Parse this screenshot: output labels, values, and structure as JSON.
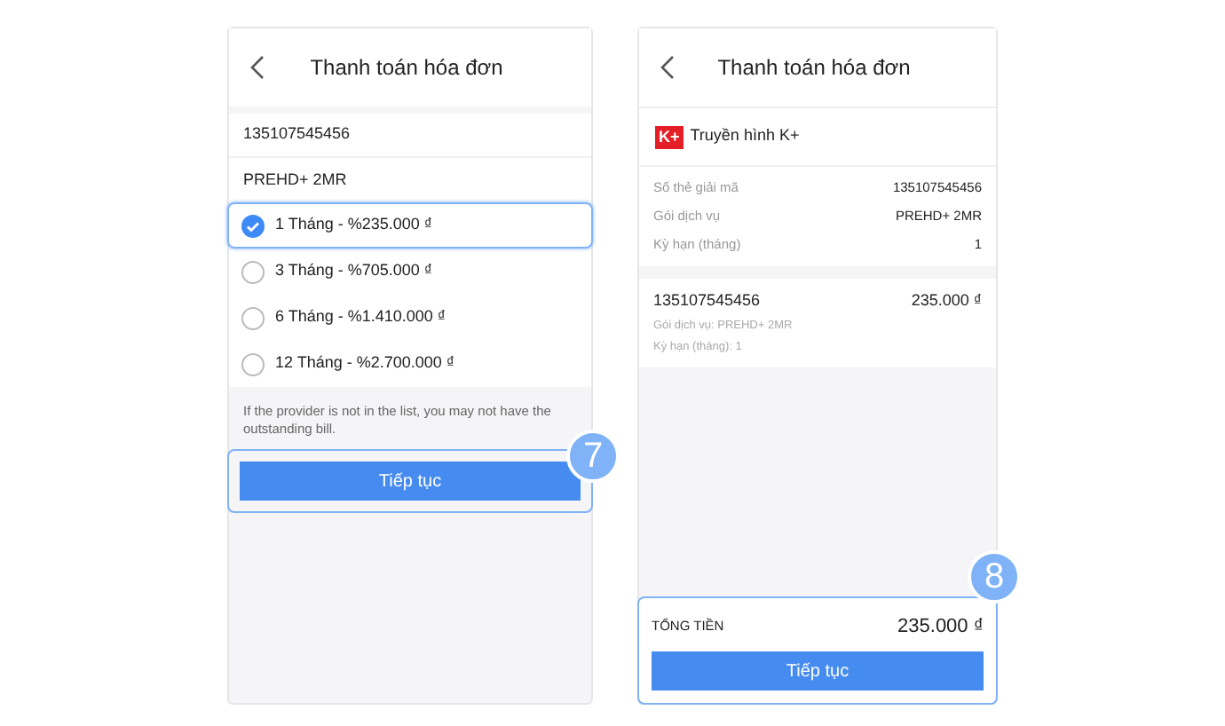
{
  "screen_1": {
    "title": "Thanh toán hóa đơn",
    "account": "135107545456",
    "package": "PREHD+ 2MR",
    "options": [
      {
        "label": "1 Tháng - %235.000 ₫",
        "selected": true
      },
      {
        "label": "3 Tháng - %705.000 ₫",
        "selected": false
      },
      {
        "label": "6 Tháng - %1.410.000 ₫",
        "selected": false
      },
      {
        "label": "12 Tháng - %2.700.000 ₫",
        "selected": false
      }
    ],
    "note": "If the provider is not in the list, you may not have the outstanding bill.",
    "button": "Tiếp tục",
    "step": "7"
  },
  "screen_2": {
    "title": "Thanh toán hóa đơn",
    "provider": {
      "logo": "K+",
      "name": "Truyền hình K+"
    },
    "details": [
      {
        "label": "Số thẻ giải mã",
        "value": "135107545456"
      },
      {
        "label": "Gói dịch vụ",
        "value": "PREHD+ 2MR"
      },
      {
        "label": "Kỳ hạn (tháng)",
        "value": "1"
      }
    ],
    "item": {
      "title": "135107545456",
      "amount": "235.000 ₫",
      "lines": [
        "Gói dịch vụ: PREHD+ 2MR",
        "Kỳ hạn (tháng): 1"
      ]
    },
    "total_label": "TỔNG TIỀN",
    "total": "235.000 ₫",
    "button": "Tiếp tục",
    "step": "8"
  }
}
